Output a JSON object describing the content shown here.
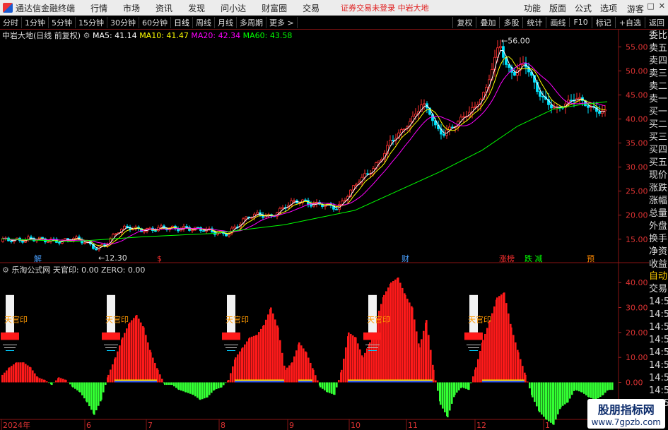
{
  "menubar": {
    "app_title": "通达信金融终端",
    "menus": [
      "行情",
      "市场",
      "资讯",
      "发现",
      "问小达",
      "财富圈",
      "交易"
    ],
    "warning": "证券交易未登录  中岩大地",
    "right": [
      "功能",
      "版面",
      "公式",
      "选项"
    ],
    "guest": "游客"
  },
  "toolbar": {
    "periods": [
      "分时",
      "1分钟",
      "5分钟",
      "15分钟",
      "30分钟",
      "60分钟",
      "日线",
      "周线",
      "月线",
      "多周期",
      "更多 >"
    ],
    "active": "日线",
    "right": [
      "复权",
      "叠加",
      "多股",
      "统计",
      "画线",
      "F10",
      "标记",
      "+自选",
      "返回"
    ]
  },
  "info": {
    "stock": "中岩大地(日线 前复权)",
    "ma5": "MA5: 41.14",
    "ma10": "MA10: 41.47",
    "ma20": "MA20: 42.34",
    "ma60": "MA60: 43.58",
    "colors": {
      "ma5": "#ffffff",
      "ma10": "#ffff00",
      "ma20": "#ff00ff",
      "ma60": "#00ff00"
    }
  },
  "indicator": {
    "label": "乐淘公式网  天官印: 0.00  ZERO: 0.00",
    "signal_text": "天官印"
  },
  "side_main": [
    "委比",
    "卖五",
    "卖四",
    "卖三",
    "卖二",
    "卖一",
    "买一",
    "买二",
    "买三",
    "买四",
    "买五",
    "现价",
    "涨跌",
    "涨幅",
    "总量",
    "外盘",
    "换手",
    "净资",
    "收益"
  ],
  "side_sub": [
    {
      "t": "自动",
      "c": "#ffcc00"
    },
    {
      "t": "交易",
      "c": "#ddd"
    },
    {
      "t": "14:55",
      "c": "#ddd"
    },
    {
      "t": "14:56",
      "c": "#ddd"
    },
    {
      "t": "14:56",
      "c": "#ddd"
    },
    {
      "t": "14:56",
      "c": "#ddd"
    },
    {
      "t": "14:56",
      "c": "#ddd"
    },
    {
      "t": "14:56",
      "c": "#ddd"
    },
    {
      "t": "14:56",
      "c": "#ddd"
    },
    {
      "t": "14:56",
      "c": "#ddd"
    },
    {
      "t": "14:56",
      "c": "#ddd"
    }
  ],
  "price_axis": {
    "labels": [
      "55.00",
      "50.00",
      "45.00",
      "40.00",
      "35.00",
      "30.00",
      "25.00",
      "20.00",
      "15.00"
    ],
    "values": [
      55,
      50,
      45,
      40,
      35,
      30,
      25,
      20,
      15
    ]
  },
  "ind_axis": {
    "labels": [
      "40.00",
      "30.00",
      "20.00",
      "10.00",
      "0.00",
      "-10.00"
    ],
    "values": [
      40,
      30,
      20,
      10,
      0,
      -10
    ]
  },
  "annotations": {
    "high": "56.00",
    "low": "12.30"
  },
  "event_tags": [
    {
      "t": "解",
      "c": "#4aa0ff"
    },
    {
      "t": "$",
      "c": "#ff3030"
    },
    {
      "t": "财",
      "c": "#4aa0ff"
    },
    {
      "t": "涨榜",
      "c": "#ff3030"
    },
    {
      "t": "跌 减",
      "c": "#00ff00"
    },
    {
      "t": "预",
      "c": "#ff8800"
    }
  ],
  "x_axis": {
    "labels": [
      "2024年",
      "6",
      "7",
      "8",
      "9",
      "10",
      "11",
      "12",
      "1"
    ]
  },
  "watermark": {
    "line1": "股朋指标网",
    "line2": "www.7gpzb.com"
  },
  "chart_data": {
    "type": "candlestick",
    "price_range": [
      11,
      58
    ],
    "indicator_range": [
      -14,
      44
    ],
    "price_path": [
      [
        0,
        14.5
      ],
      [
        20,
        15
      ],
      [
        40,
        15.2
      ],
      [
        60,
        14.5
      ],
      [
        80,
        14.8
      ],
      [
        100,
        15.2
      ],
      [
        120,
        14.0
      ],
      [
        135,
        13.2
      ],
      [
        150,
        14.5
      ],
      [
        165,
        16.5
      ],
      [
        180,
        17.3
      ],
      [
        200,
        17.2
      ],
      [
        220,
        17.0
      ],
      [
        240,
        17.2
      ],
      [
        260,
        17.6
      ],
      [
        280,
        16.8
      ],
      [
        300,
        16.5
      ],
      [
        320,
        16.4
      ],
      [
        335,
        17.8
      ],
      [
        350,
        19.5
      ],
      [
        365,
        20.5
      ],
      [
        380,
        19.8
      ],
      [
        395,
        20.8
      ],
      [
        410,
        22.5
      ],
      [
        425,
        23.3
      ],
      [
        440,
        22.3
      ],
      [
        460,
        21.8
      ],
      [
        475,
        21.5
      ],
      [
        490,
        24.5
      ],
      [
        505,
        27.0
      ],
      [
        520,
        28.5
      ],
      [
        535,
        31.5
      ],
      [
        550,
        35.5
      ],
      [
        565,
        37.0
      ],
      [
        580,
        39.5
      ],
      [
        595,
        43.5
      ],
      [
        605,
        42.0
      ],
      [
        615,
        38.0
      ],
      [
        625,
        36.5
      ],
      [
        640,
        38.5
      ],
      [
        655,
        41.0
      ],
      [
        670,
        42.5
      ],
      [
        685,
        45.5
      ],
      [
        695,
        51.0
      ],
      [
        705,
        56.0
      ],
      [
        715,
        51.0
      ],
      [
        725,
        49.5
      ],
      [
        740,
        51.5
      ],
      [
        750,
        48.5
      ],
      [
        760,
        45.5
      ],
      [
        770,
        44.0
      ],
      [
        785,
        42.0
      ],
      [
        800,
        43.0
      ],
      [
        815,
        44.5
      ],
      [
        830,
        43.0
      ],
      [
        845,
        41.5
      ],
      [
        857,
        41.1
      ]
    ],
    "ma60_path": [
      [
        0,
        15.1
      ],
      [
        100,
        14.5
      ],
      [
        200,
        15.5
      ],
      [
        300,
        16.2
      ],
      [
        400,
        18.0
      ],
      [
        500,
        21.0
      ],
      [
        560,
        25.0
      ],
      [
        620,
        29.0
      ],
      [
        680,
        33.5
      ],
      [
        730,
        38.5
      ],
      [
        780,
        42.0
      ],
      [
        820,
        43.0
      ],
      [
        857,
        43.6
      ]
    ],
    "indicator_bars": [
      [
        0,
        3
      ],
      [
        10,
        6
      ],
      [
        20,
        8
      ],
      [
        30,
        8
      ],
      [
        40,
        6
      ],
      [
        50,
        2
      ],
      [
        60,
        1
      ],
      [
        70,
        -1
      ],
      [
        80,
        2
      ],
      [
        90,
        1
      ],
      [
        100,
        -2
      ],
      [
        110,
        -4
      ],
      [
        120,
        -8
      ],
      [
        130,
        -13
      ],
      [
        140,
        -7
      ],
      [
        150,
        3
      ],
      [
        160,
        10
      ],
      [
        170,
        18
      ],
      [
        180,
        24
      ],
      [
        190,
        27
      ],
      [
        200,
        22
      ],
      [
        210,
        12
      ],
      [
        220,
        5
      ],
      [
        230,
        -1
      ],
      [
        240,
        -1
      ],
      [
        250,
        -3
      ],
      [
        260,
        -4
      ],
      [
        270,
        -5
      ],
      [
        280,
        -7
      ],
      [
        290,
        -6
      ],
      [
        300,
        -3
      ],
      [
        310,
        -2
      ],
      [
        320,
        1
      ],
      [
        330,
        10
      ],
      [
        340,
        14
      ],
      [
        350,
        18
      ],
      [
        360,
        19
      ],
      [
        370,
        23
      ],
      [
        380,
        30
      ],
      [
        390,
        22
      ],
      [
        400,
        5
      ],
      [
        410,
        8
      ],
      [
        420,
        16
      ],
      [
        430,
        12
      ],
      [
        440,
        5
      ],
      [
        450,
        -2
      ],
      [
        460,
        -4
      ],
      [
        470,
        -5
      ],
      [
        480,
        5
      ],
      [
        490,
        20
      ],
      [
        500,
        18
      ],
      [
        510,
        10
      ],
      [
        520,
        16
      ],
      [
        530,
        26
      ],
      [
        540,
        35
      ],
      [
        550,
        40
      ],
      [
        560,
        42
      ],
      [
        570,
        35
      ],
      [
        580,
        30
      ],
      [
        590,
        14
      ],
      [
        600,
        25
      ],
      [
        610,
        5
      ],
      [
        620,
        -9
      ],
      [
        630,
        -14
      ],
      [
        640,
        -5
      ],
      [
        650,
        -2
      ],
      [
        660,
        -3
      ],
      [
        670,
        6
      ],
      [
        680,
        17
      ],
      [
        690,
        25
      ],
      [
        700,
        34
      ],
      [
        710,
        36
      ],
      [
        720,
        22
      ],
      [
        730,
        12
      ],
      [
        740,
        3
      ],
      [
        750,
        -6
      ],
      [
        760,
        -12
      ],
      [
        770,
        -15
      ],
      [
        780,
        -17
      ],
      [
        790,
        -10
      ],
      [
        800,
        -8
      ],
      [
        810,
        -3
      ],
      [
        820,
        -4
      ],
      [
        830,
        -6
      ],
      [
        840,
        -7
      ],
      [
        850,
        -5
      ],
      [
        857,
        -3
      ]
    ],
    "signals_x": [
      12,
      155,
      325,
      525,
      668
    ]
  }
}
